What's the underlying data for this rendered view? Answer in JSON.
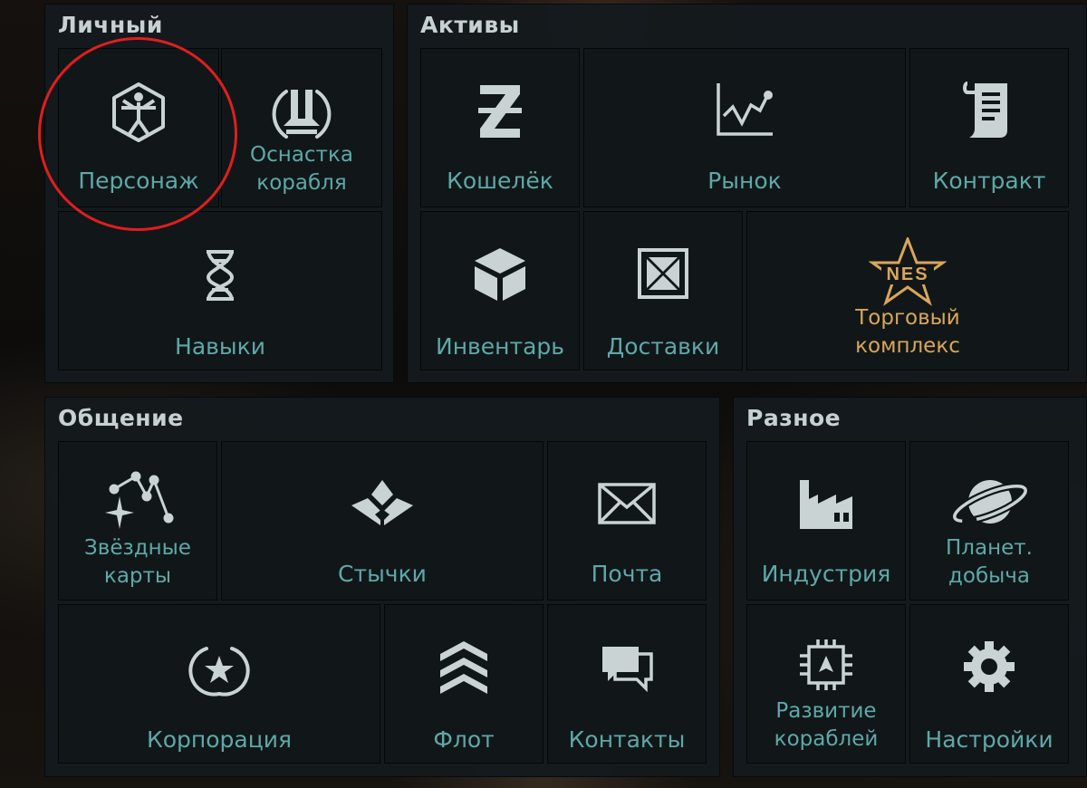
{
  "sections": {
    "personal": {
      "title": "Личный",
      "tiles": {
        "character": {
          "label": "Персонаж",
          "icon": "vitruvian-hexagon-icon"
        },
        "fitting": {
          "label": "Оснастка\nкорабля",
          "icon": "ship-fitting-icon"
        },
        "skills": {
          "label": "Навыки",
          "icon": "dna-skills-icon"
        }
      }
    },
    "assets": {
      "title": "Активы",
      "tiles": {
        "wallet": {
          "label": "Кошелёк",
          "icon": "z-wallet-icon"
        },
        "market": {
          "label": "Рынок",
          "icon": "market-chart-icon"
        },
        "contract": {
          "label": "Контракт",
          "icon": "scroll-contract-icon"
        },
        "inventory": {
          "label": "Инвентарь",
          "icon": "cube-inventory-icon"
        },
        "deliveries": {
          "label": "Доставки",
          "icon": "crate-delivery-icon"
        },
        "trade_complex": {
          "label": "Торговый\nкомплекс",
          "logo_text": "NES",
          "icon": "nes-star-logo-icon"
        }
      }
    },
    "social": {
      "title": "Общение",
      "tiles": {
        "star_maps": {
          "label": "Звёздные\nкарты",
          "icon": "constellation-icon"
        },
        "skirmish": {
          "label": "Стычки",
          "icon": "skirmish-diamond-icon"
        },
        "mail": {
          "label": "Почта",
          "icon": "envelope-icon"
        },
        "corporation": {
          "label": "Корпорация",
          "icon": "star-wreath-icon"
        },
        "fleet": {
          "label": "Флот",
          "icon": "chevrons-fleet-icon"
        },
        "contacts": {
          "label": "Контакты",
          "icon": "chat-bubbles-icon"
        }
      }
    },
    "misc": {
      "title": "Разное",
      "tiles": {
        "industry": {
          "label": "Индустрия",
          "icon": "factory-icon"
        },
        "planetary": {
          "label": "Планет.\nдобыча",
          "icon": "planet-ring-icon"
        },
        "ship_dev": {
          "label": "Развитие\nкораблей",
          "icon": "ship-development-icon"
        },
        "settings": {
          "label": "Настройки",
          "icon": "gear-icon"
        }
      }
    }
  },
  "colors": {
    "label": "#5fa8a8",
    "icon": "#c9d3d4",
    "title": "#c7d0d2",
    "gold": "#d9a65a",
    "highlight": "#e01e1e"
  }
}
